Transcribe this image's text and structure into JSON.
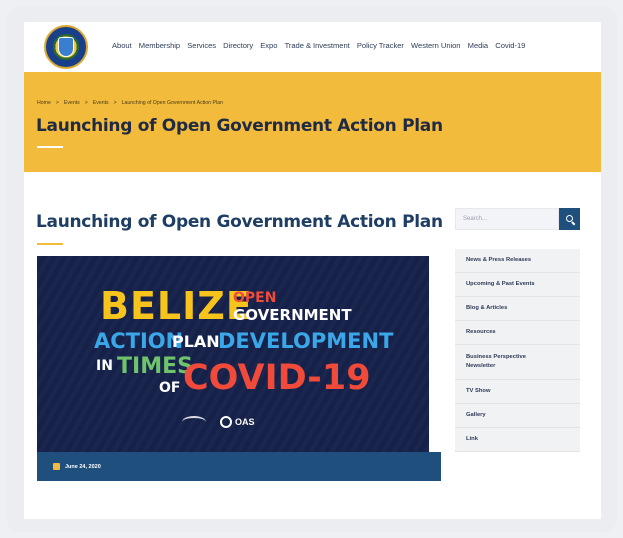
{
  "nav": {
    "items": [
      "About",
      "Membership",
      "Services",
      "Directory",
      "Expo",
      "Trade & Investment",
      "Policy Tracker",
      "Western Union",
      "Media",
      "Covid-19"
    ]
  },
  "breadcrumb": [
    "Home",
    ">",
    "Events",
    ">",
    "Events",
    ">",
    "Launching of Open Government Action Plan"
  ],
  "hero": {
    "title": "Launching of Open Government Action Plan"
  },
  "article": {
    "title": "Launching of Open Government Action Plan",
    "date": "June 24, 2020",
    "image_text": {
      "belize": "BELIZE",
      "open": "OPEN",
      "government": "GOVERNMENT",
      "action": "ACTION",
      "plan": "PLAN",
      "development": "DEVELOPMENT",
      "in": "IN",
      "times": "TIMES",
      "of": "OF",
      "covid": "COVID-19",
      "oas": "OAS"
    }
  },
  "search": {
    "placeholder": "Search..."
  },
  "sidebar": {
    "items": [
      "News & Press Releases",
      "Upcoming & Past Events",
      "Blog & Articles",
      "Resources",
      "Business Perspective Newsletter",
      "TV Show",
      "Gallery",
      "Link"
    ]
  },
  "colors": {
    "brand_yellow": "#f2bb3b",
    "brand_navy": "#1e4f7d",
    "title_navy": "#1f3e64"
  }
}
